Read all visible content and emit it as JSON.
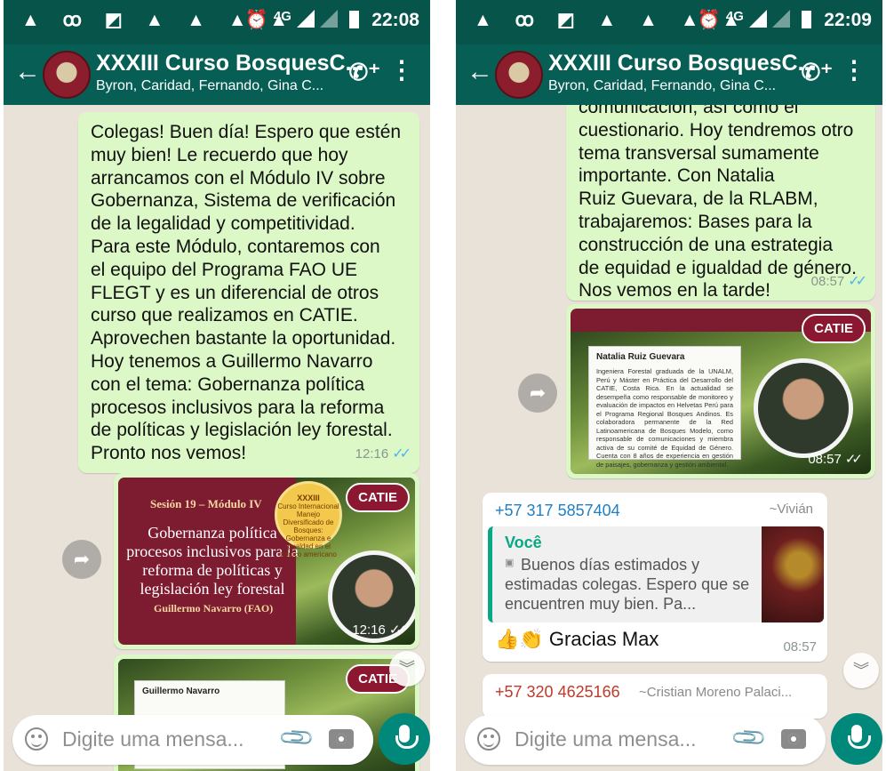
{
  "screens": [
    {
      "status": {
        "icons": "▲ ꝏ ◩ ▲ ▲ ▲ ▲",
        "alarm": "⏰",
        "network": "4G",
        "time": "22:08"
      },
      "header": {
        "title": "XXXIII Curso BosquesC...",
        "subtitle": "Byron, Caridad, Fernando, Gina C..."
      },
      "messages": {
        "text1": "Colegas! Buen día! Espero que estén\nmuy bien! Le recuerdo que hoy\narrancamos con el Módulo IV sobre\nGobernanza, Sistema de verificación\nde la legalidad y competitividad.\nPara este Módulo, contaremos con\nel equipo del Programa FAO UE\nFLEGT y es un diferencial de otros\ncurso que realizamos en CATIE.\nAprovechen bastante la oportunidad.\nHoy tenemos a Guillermo Navarro\ncon el tema: Gobernanza política\nprocesos inclusivos para la reforma\nde políticas y legislación ley forestal.\nPronto nos vemos!",
        "text1_time": "12:16",
        "image1": {
          "session": "Sesión 19 – Módulo IV",
          "title": "Gobernanza política procesos inclusivos para la reforma de políticas y legislación ley forestal",
          "author": "Guillermo Navarro (FAO)",
          "badge_title": "XXXIII",
          "badge_text": "Curso Internacional Manejo Diversificado de Bosques: Gobernanza e igualdad en el trópico americano",
          "brand": "CATIE",
          "time": "12:16"
        },
        "image2": {
          "name": "Guillermo Navarro",
          "brand": "CATIE"
        }
      },
      "input": {
        "placeholder": "Digite uma mensa..."
      }
    },
    {
      "status": {
        "icons": "▲ ꝏ ◩ ▲ ▲ ▲ ▲",
        "alarm": "⏰",
        "network": "4G",
        "time": "22:09"
      },
      "header": {
        "title": "XXXIII Curso BosquesC...",
        "subtitle": "Byron, Caridad, Fernando, Gina C..."
      },
      "messages": {
        "text1": "comunicación, así como el\ncuestionario. Hoy tendremos otro\ntema transversal sumamente\nimportante. Con Natalia\nRuiz Guevara, de la RLABM,\ntrabajaremos: Bases para la\nconstrucción de una estrategia\nde equidad e igualdad de género.\nNos vemos en la tarde!",
        "text1_time": "08:57",
        "image1": {
          "brand": "CATIE",
          "name": "Natalia Ruiz Guevara",
          "bio": "Ingeniera Forestal graduada de la UNALM, Perú y Máster en Práctica del Desarrollo del CATIE, Costa Rica. En la actualidad se desempeña como responsable de monitoreo y evaluación de impactos en Helvetas Perú para el Programa Regional Bosques Andinos. Es colaboradora permanente de la Red Latinoamericana de Bosques Modelo, como responsable de comunicaciones y miembra activa de su comité de Equidad de Género. Cuenta con 8 años de experiencia en gestión de paisajes, gobernanza y gestión ambiental.",
          "time": "08:57"
        },
        "reply": {
          "sender": "+57 317 5857404",
          "sender_name": "~Vivián",
          "quoted_author": "Você",
          "quoted_text": "Buenos días estimados y estimadas colegas. Espero que se encuentren muy bien. Pa...",
          "emoji": "👍👏",
          "text": "Gracias Max",
          "time": "08:57"
        },
        "next": {
          "sender": "+57 320 4625166",
          "sender_name": "~Cristian Moreno Palaci..."
        }
      },
      "input": {
        "placeholder": "Digite uma mensa..."
      }
    }
  ],
  "colors": {
    "header": "#075e54",
    "statusbar": "#06544a",
    "outgoing": "#dcf8c6",
    "incoming": "#ffffff",
    "mic": "#00897b",
    "ticks": "#4fb6ec",
    "catie": "#8b1730"
  }
}
